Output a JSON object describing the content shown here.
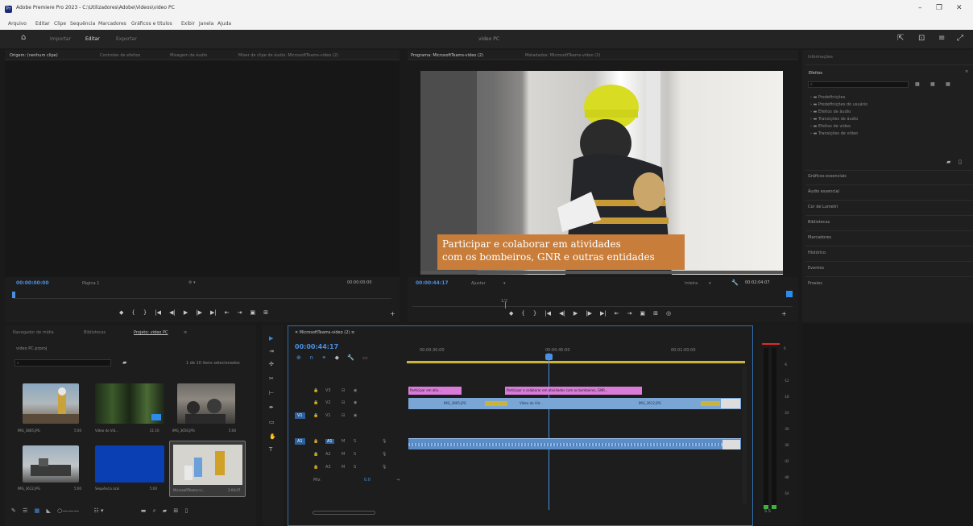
{
  "window": {
    "title": "Adobe Premiere Pro 2023 - C:\\Utilizadores\\Adobe\\Videos\\video PC",
    "app_icon_text": "Pr",
    "controls": [
      "–",
      "❐",
      "✕"
    ]
  },
  "menu": [
    "Arquivo",
    "Editar",
    "Clipe",
    "Sequência",
    "Marcadores",
    "Gráficos e títulos",
    "Exibir",
    "Janela",
    "Ajuda"
  ],
  "workspace": {
    "tabs": [
      "Importar",
      "Editar",
      "Exportar"
    ],
    "active": "Editar",
    "title": "video PC"
  },
  "source_monitor": {
    "tabs": [
      "Origem: (nenhum clipe)",
      "Controles de efeitos",
      "Mixagem de áudio",
      "Mixer de clipe de áudio: MicrosoftTeams-video (2)"
    ],
    "timecode_left": "00:00:00:00",
    "fit": "Página 1",
    "timecode_right": "00:00:00:00",
    "transport": [
      "◆",
      "{",
      "}",
      "|◀",
      "◀|",
      "▶",
      "|▶",
      "▶|",
      "⇤",
      "⇥",
      "▣",
      "⊞"
    ]
  },
  "program_monitor": {
    "tabs": [
      "Programa: MicrosoftTeams-video (2)",
      "Metadados: MicrosoftTeams-video (2)"
    ],
    "subtitle_line1": "Participar e colaborar em atividades",
    "subtitle_line2": "com os bombeiros, GNR e outras entidades",
    "timecode": "00:00:44:17",
    "fit": "Ajustar",
    "quality": "Inteira",
    "duration": "00:02:04:07",
    "scale": "1/2",
    "transport": [
      "◆",
      "{",
      "}",
      "|◀",
      "◀|",
      "▶",
      "|▶",
      "▶|",
      "⇤",
      "⇥",
      "▣",
      "⊞",
      "◎"
    ]
  },
  "right_panel": {
    "header": "Informações",
    "section": "Efeitos",
    "search_placeholder": "",
    "tree": [
      "Predefinições",
      "Predefinições do usuário",
      "Efeitos de áudio",
      "Transições de áudio",
      "Efeitos de vídeo",
      "Transições de vídeo"
    ],
    "items": [
      "Gráficos essenciais",
      "Áudio essencial",
      "Cor de Lumetri",
      "Bibliotecas",
      "Marcadores",
      "Histórico",
      "Eventos",
      "Proxies"
    ]
  },
  "project": {
    "tabs": [
      "Navegador de mídia",
      "Bibliotecas",
      "Projeto: video PC"
    ],
    "path": "video PC.prproj",
    "item_count": "1 de 10 itens selecionados",
    "clips": [
      {
        "name": "IMG_3865.JPG",
        "dur": "5:00"
      },
      {
        "name": "Vídeo do Vid...",
        "dur": "21:10"
      },
      {
        "name": "IMG_3656.JPG",
        "dur": "5:00"
      },
      {
        "name": "IMG_3612.JPG",
        "dur": "5:00"
      },
      {
        "name": "Sequência azul",
        "dur": "5:00"
      },
      {
        "name": "MicrosoftTeams-vi...",
        "dur": "2:04:07"
      }
    ]
  },
  "timeline": {
    "tab": "MicrosoftTeams-video (2)",
    "timecode": "00:00:44:17",
    "ruler": [
      "00:00:30:00",
      "00:00:45:00",
      "00:01:00:00"
    ],
    "graphic_clips": [
      "Participar em ativ...",
      "Participar e colaborar em atividades com os bombeiros, GNR..."
    ],
    "video_clips": [
      "IMG_3865.JPG",
      "Vídeo do Vid...",
      "IMG_3612.JPG"
    ],
    "tracks": [
      "V3",
      "V2",
      "V1",
      "A1",
      "A2",
      "A3",
      "Mix"
    ]
  },
  "meters": {
    "scale": [
      "0",
      "-6",
      "-12",
      "-18",
      "-24",
      "-30",
      "-36",
      "-42",
      "-48",
      "-54"
    ],
    "footer": "S S"
  },
  "colors": {
    "accent_blue": "#2d8ceb",
    "playhead": "#4a90e2",
    "graphic_clip": "#d97bd9",
    "video_clip": "#7aa6d6",
    "audio_clip": "#5b8dc8",
    "subtitle_bg": "#c87d3a"
  }
}
